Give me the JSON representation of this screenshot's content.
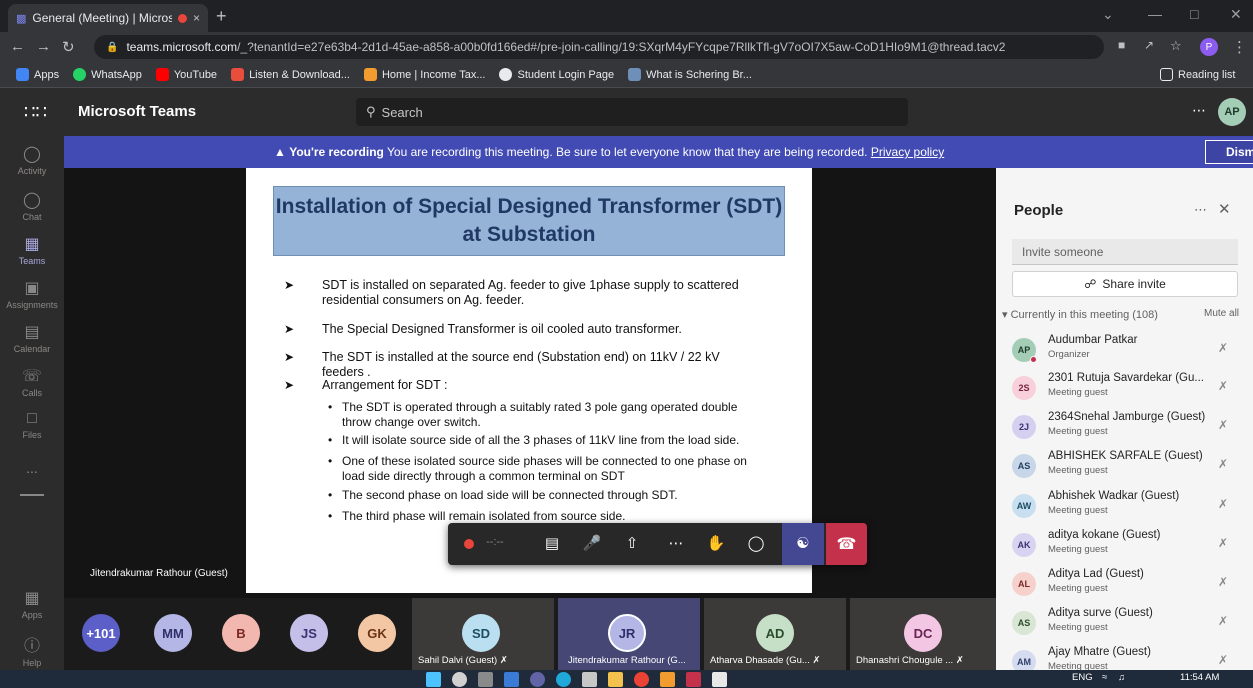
{
  "browser": {
    "tab_title": "General (Meeting) | Microsoft",
    "tab_close": "×",
    "new_tab": "+",
    "url_domain": "teams.microsoft.com",
    "url_rest": "/_?tenantId=e27e63b4-2d1d-45ae-a858-a00b0fd166ed#/pre-join-calling/19:SXqrM4yFYcqpe7RllkTfl-gV7oOI7X5aw-CoD1HIo9M1@thread.tacv2",
    "bookmarks": [
      "Apps",
      "WhatsApp",
      "YouTube",
      "Listen & Download...",
      "Home | Income Tax...",
      "Student Login Page",
      "What is Schering Br..."
    ],
    "reading_list": "Reading list",
    "profile_initial": "P"
  },
  "teams": {
    "app_name": "Microsoft Teams",
    "search_placeholder": "Search",
    "user_initials": "AP",
    "rail": [
      {
        "label": "Activity",
        "icon": "bell-icon"
      },
      {
        "label": "Chat",
        "icon": "chat-icon"
      },
      {
        "label": "Teams",
        "icon": "teams-icon"
      },
      {
        "label": "Assignments",
        "icon": "assignments-icon"
      },
      {
        "label": "Calendar",
        "icon": "calendar-icon"
      },
      {
        "label": "Calls",
        "icon": "phone-icon"
      },
      {
        "label": "Files",
        "icon": "file-icon"
      },
      {
        "label": "...",
        "icon": "more-icon"
      },
      {
        "label": "Apps",
        "icon": "apps-icon"
      },
      {
        "label": "Help",
        "icon": "help-icon"
      }
    ]
  },
  "banner": {
    "bold": "You're recording",
    "text": " You are recording this meeting. Be sure to let everyone know that they are being recorded. ",
    "link": "Privacy policy",
    "dismiss": "Dismiss"
  },
  "slide": {
    "title_line1": "Installation of Special Designed Transformer (SDT)",
    "title_line2": "at Substation",
    "bullets": [
      "SDT is installed on separated Ag. feeder to give 1phase supply to scattered residential consumers on Ag. feeder.",
      "The Special Designed Transformer is oil cooled auto transformer.",
      "The SDT is installed at the source end (Substation end) on 11kV / 22 kV feeders .",
      "Arrangement for SDT :"
    ],
    "sub_bullets": [
      "The SDT is operated through a suitably rated 3 pole gang operated double throw change over switch.",
      "It will isolate source side of all the 3 phases of 11kV line from the load side.",
      "One of these isolated source side phases will be connected to one phase on load side directly through a common terminal on SDT",
      "The second phase on load side will be connected through SDT.",
      "The third phase will remain isolated from source side."
    ]
  },
  "presenter_name": "Jitendrakumar Rathour (Guest)",
  "controls": {
    "timer": "--:--"
  },
  "tiles": [
    {
      "initials": "+101",
      "color": "#5b5fc7",
      "fg": "#ffffff"
    },
    {
      "initials": "MM",
      "color": "#b4b7e6",
      "fg": "#2f2f6b"
    },
    {
      "initials": "B",
      "color": "#f2b8b0",
      "fg": "#7a2a22"
    },
    {
      "initials": "JS",
      "color": "#c4bfe8",
      "fg": "#3a3272"
    },
    {
      "initials": "GK",
      "color": "#f4c7a4",
      "fg": "#6b3412"
    },
    {
      "initials": "SD",
      "color": "#b9dff0",
      "fg": "#1d4d63",
      "name": "Sahil Dalvi (Guest)"
    },
    {
      "initials": "JR",
      "color": "#b4b7e6",
      "fg": "#2f2f6b",
      "name": "Jitendrakumar Rathour (G..."
    },
    {
      "initials": "AD",
      "color": "#c6dfc7",
      "fg": "#2a4d2c",
      "name": "Atharva Dhasade (Gu..."
    },
    {
      "initials": "DC",
      "color": "#f3c6e3",
      "fg": "#6b2454",
      "name": "Dhanashri Chougule ..."
    }
  ],
  "people": {
    "title": "People",
    "invite_placeholder": "Invite someone",
    "share_invite": "Share invite",
    "current_label": "Currently in this meeting (108)",
    "mute_all": "Mute all",
    "list": [
      {
        "initials": "AP",
        "name": "Audumbar Patkar",
        "role": "Organizer",
        "color": "#a4cdb6",
        "fg": "#1e3a2a"
      },
      {
        "initials": "2S",
        "name": "2301 Rutuja Savardekar (Gu...",
        "role": "Meeting guest",
        "color": "#f8d0dc",
        "fg": "#7a2340"
      },
      {
        "initials": "2J",
        "name": "2364Snehal Jamburge (Guest)",
        "role": "Meeting guest",
        "color": "#d5cff0",
        "fg": "#3a3272"
      },
      {
        "initials": "AS",
        "name": "ABHISHEK SARFALE (Guest)",
        "role": "Meeting guest",
        "color": "#c7d6e8",
        "fg": "#23405e"
      },
      {
        "initials": "AW",
        "name": "Abhishek Wadkar (Guest)",
        "role": "Meeting guest",
        "color": "#c7dff0",
        "fg": "#1d4d63"
      },
      {
        "initials": "AK",
        "name": "aditya kokane (Guest)",
        "role": "Meeting guest",
        "color": "#d9d3f2",
        "fg": "#3a3272"
      },
      {
        "initials": "AL",
        "name": "Aditya Lad (Guest)",
        "role": "Meeting guest",
        "color": "#f6d1cc",
        "fg": "#7a2a22"
      },
      {
        "initials": "AS",
        "name": "Aditya surve (Guest)",
        "role": "Meeting guest",
        "color": "#d8e6d3",
        "fg": "#2a4d2c"
      },
      {
        "initials": "AM",
        "name": "Ajay Mhatre (Guest)",
        "role": "Meeting guest",
        "color": "#d6dcf0",
        "fg": "#2f3f6b"
      }
    ]
  },
  "taskbar": {
    "lang": "ENG",
    "time": "11:54 AM"
  }
}
